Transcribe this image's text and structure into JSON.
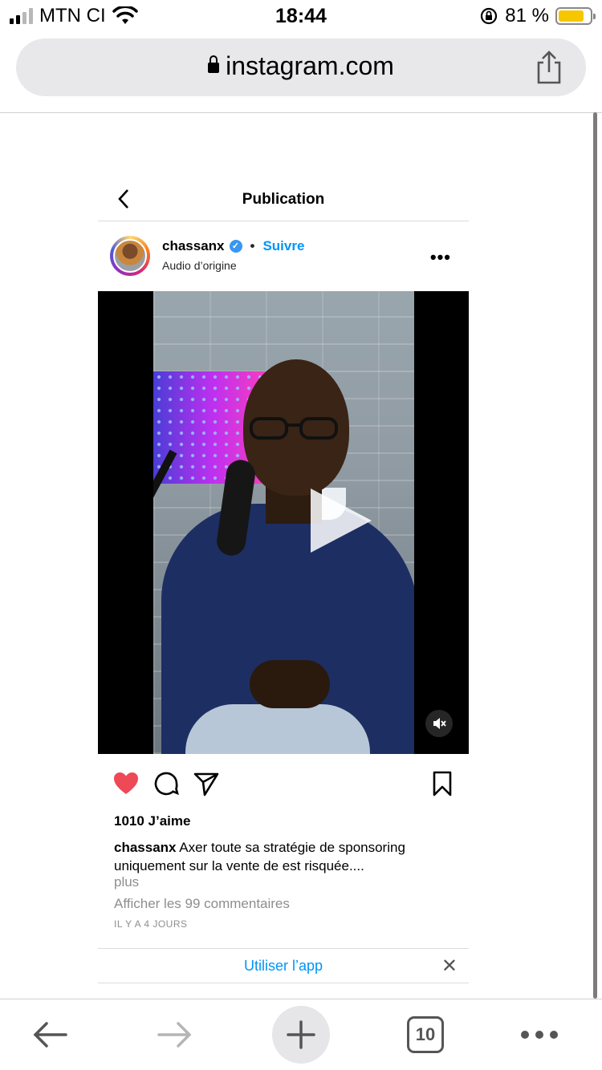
{
  "status_bar": {
    "carrier": "MTN CI",
    "time": "18:44",
    "battery_percent": "81 %",
    "battery_level": 0.81
  },
  "browser": {
    "url": "instagram.com"
  },
  "post": {
    "header_title": "Publication",
    "username": "chassanx",
    "follow_label": "Suivre",
    "audio_label": "Audio d’origine",
    "likes": "1010 J’aime",
    "caption_user": "chassanx",
    "caption_text": "Axer toute sa stratégie de sponsoring uniquement sur la vente de est risquée....",
    "more_label": "plus",
    "comments_link": "Afficher les 99 commentaires",
    "time_ago": "IL Y A 4 JOURS",
    "liked": true
  },
  "app_banner": {
    "label": "Utiliser l’app"
  },
  "toolbar": {
    "tab_count": "10"
  },
  "icons": [
    "signal-icon",
    "wifi-icon",
    "rotation-lock-icon",
    "battery-icon",
    "lock-icon",
    "share-icon",
    "back-chevron-icon",
    "verified-icon",
    "more-icon",
    "play-icon",
    "mute-icon",
    "heart-icon",
    "comment-icon",
    "send-icon",
    "bookmark-icon",
    "close-icon",
    "back-arrow-icon",
    "forward-arrow-icon",
    "plus-icon",
    "tabs-icon",
    "ellipsis-icon"
  ],
  "colors": {
    "link_blue": "#0095f6",
    "like_red": "#ed4956",
    "battery_yellow": "#f6c600"
  }
}
